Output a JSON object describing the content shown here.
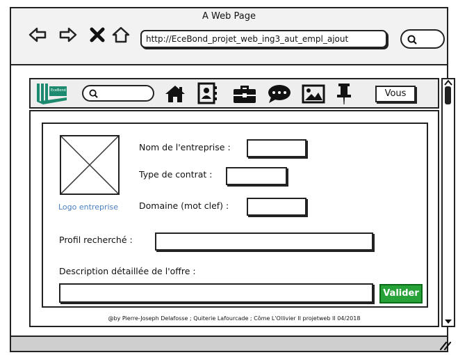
{
  "window": {
    "title": "A Web Page"
  },
  "browser": {
    "url": "http://EceBond_projet_web_ing3_aut_empl_ajout"
  },
  "brand": {
    "logo_text": "EceBond"
  },
  "topnav": {
    "icons": [
      "home-icon",
      "profile-icon",
      "briefcase-icon",
      "chat-icon",
      "image-icon",
      "pin-icon"
    ],
    "user_button": "Vous"
  },
  "form": {
    "logo_caption": "Logo entreprise",
    "company_label": "Nom de l'entreprise :",
    "company_value": "",
    "contract_label": "Type de contrat :",
    "contract_value": "",
    "domain_label": "Domaine (mot clef) :",
    "domain_value": "",
    "profile_label": "Profil recherché :",
    "profile_value": "",
    "description_label": "Description détaillée de l'offre :",
    "description_value": "",
    "submit_label": "Valider"
  },
  "footer": {
    "text": "@by Pierre-Joseph Delafosse ; Quiterie Lafourcade ; Côme L'Ollivier II projetweb II 04/2018"
  },
  "colors": {
    "accent": "#27a238",
    "link": "#4a7fc1",
    "brand": "#1c8a6e"
  }
}
